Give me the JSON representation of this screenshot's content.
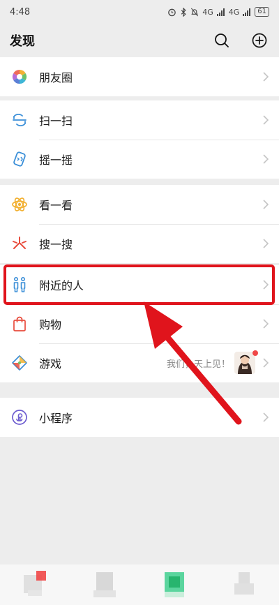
{
  "status": {
    "time": "4:48",
    "signal1": "4G",
    "signal2": "4G",
    "battery": "61"
  },
  "header": {
    "title": "发现"
  },
  "groups": [
    {
      "items": [
        {
          "label": "朋友圈",
          "icon": "moments-aperture-icon"
        }
      ]
    },
    {
      "items": [
        {
          "label": "扫一扫",
          "icon": "scan-icon"
        },
        {
          "label": "摇一摇",
          "icon": "shake-icon"
        }
      ]
    },
    {
      "items": [
        {
          "label": "看一看",
          "icon": "top-stories-icon"
        },
        {
          "label": "搜一搜",
          "icon": "search-spark-icon"
        }
      ]
    },
    {
      "items": [
        {
          "label": "附近的人",
          "icon": "people-nearby-icon"
        },
        {
          "label": "购物",
          "icon": "shopping-bag-icon"
        },
        {
          "label": "游戏",
          "icon": "games-icon",
          "extra": "我们，天上见！"
        }
      ]
    },
    {
      "items": [
        {
          "label": "小程序",
          "icon": "mini-programs-icon"
        }
      ]
    }
  ],
  "colors": {
    "highlight": "#e0141c",
    "accent": "#07c160"
  }
}
